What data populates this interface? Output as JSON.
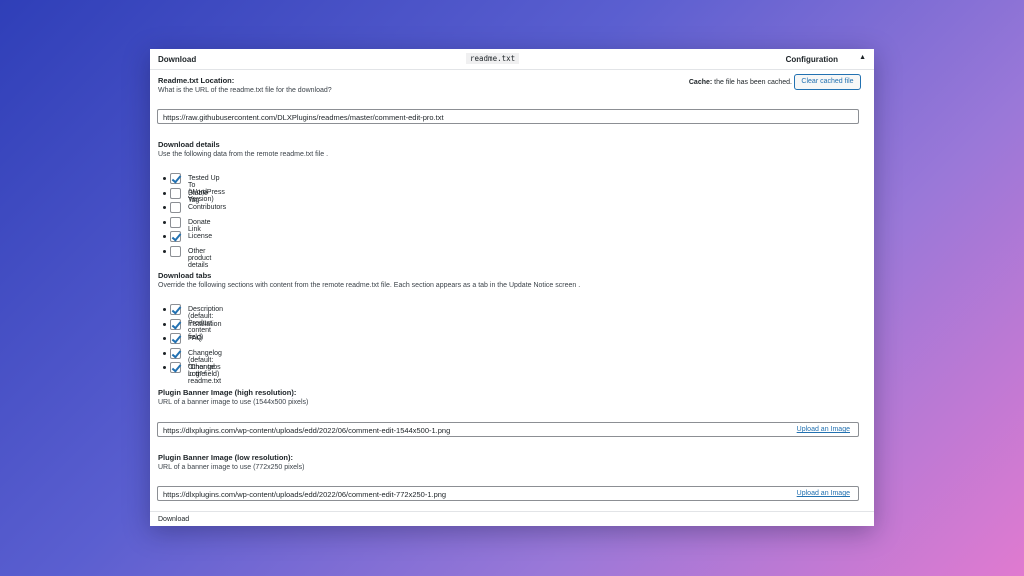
{
  "header": {
    "title": "Download",
    "code_label": "readme.txt",
    "config": "Configuration",
    "toggle": "▲"
  },
  "readme": {
    "label": "Readme.txt Location:",
    "desc": "What is the URL of the readme.txt file for the download?",
    "value": "https://raw.githubusercontent.com/DLXPlugins/readmes/master/comment-edit-pro.txt",
    "cache_label": "Cache:",
    "cache_text": " the file has been cached.",
    "clear_button": "Clear cached file"
  },
  "details": {
    "label": "Download details",
    "desc": "Use the following data from the remote readme.txt file .",
    "items": [
      {
        "label": "Tested Up To (WordPress Version)",
        "checked": true
      },
      {
        "label": "Stable Tag",
        "checked": false
      },
      {
        "label": "Contributors",
        "checked": false
      },
      {
        "label": "Donate Link",
        "checked": false
      },
      {
        "label": "License",
        "checked": true
      },
      {
        "label": "Other product details",
        "checked": false
      }
    ]
  },
  "tabs": {
    "label": "Download tabs",
    "desc": "Override the following sections with content from the remote readme.txt file. Each section appears as a tab in the Update Notice screen .",
    "items": [
      {
        "label": "Description (default: Product content field)",
        "checked": true
      },
      {
        "label": "Installation",
        "checked": true
      },
      {
        "label": "FAQ",
        "checked": true
      },
      {
        "label": "Changelog (default: \"Change Log\" field)",
        "checked": true
      },
      {
        "label": "Other tabs in the readme.txt",
        "checked": true
      }
    ]
  },
  "banner_high": {
    "label": "Plugin Banner Image (high resolution):",
    "desc": "URL of a banner image to use (1544x500 pixels)",
    "value": "https://dlxplugins.com/wp-content/uploads/edd/2022/06/comment-edit-1544x500-1.png",
    "upload": "Upload an Image"
  },
  "banner_low": {
    "label": "Plugin Banner Image (low resolution):",
    "desc": "URL of a banner image to use (772x250 pixels)",
    "value": "https://dlxplugins.com/wp-content/uploads/edd/2022/06/comment-edit-772x250-1.png",
    "upload": "Upload an Image"
  },
  "footer": {
    "title": "Download"
  }
}
